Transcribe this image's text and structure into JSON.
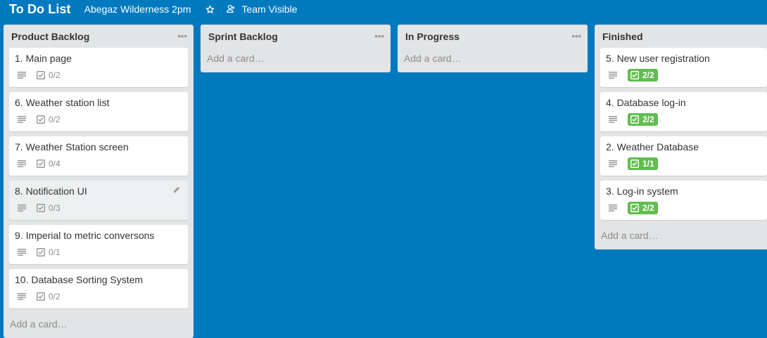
{
  "header": {
    "title": "To Do List",
    "board_name": "Abegaz Wilderness 2pm",
    "visibility": "Team Visible"
  },
  "lists": [
    {
      "title": "Product Backlog",
      "add_card": "Add a card…",
      "cards": [
        {
          "title": "1. Main page",
          "checklist": "0/2"
        },
        {
          "title": "6. Weather station list",
          "checklist": "0/2"
        },
        {
          "title": "7. Weather Station screen",
          "checklist": "0/4"
        },
        {
          "title": "8. Notification UI",
          "checklist": "0/3"
        },
        {
          "title": "9. Imperial to metric conversons",
          "checklist": "0/1"
        },
        {
          "title": "10. Database Sorting System",
          "checklist": "0/2"
        }
      ]
    },
    {
      "title": "Sprint Backlog",
      "add_card": "Add a card…",
      "cards": []
    },
    {
      "title": "In Progress",
      "add_card": "Add a card…",
      "cards": []
    },
    {
      "title": "Finished",
      "add_card": "Add a card…",
      "cards": [
        {
          "title": "5. New user registration",
          "checklist": "2/2"
        },
        {
          "title": "4. Database log-in",
          "checklist": "2/2"
        },
        {
          "title": "2. Weather Database",
          "checklist": "1/1"
        },
        {
          "title": "3. Log-in system",
          "checklist": "2/2"
        }
      ]
    }
  ],
  "colors": {
    "board_bg": "#0079bf",
    "list_bg": "#e2e4e6",
    "complete_badge": "#61bd4f"
  },
  "icons": {
    "star": "star-icon",
    "team": "team-icon",
    "list_menu": "ellipsis-icon",
    "description": "description-icon",
    "checklist": "checklist-icon",
    "edit": "pencil-icon"
  }
}
